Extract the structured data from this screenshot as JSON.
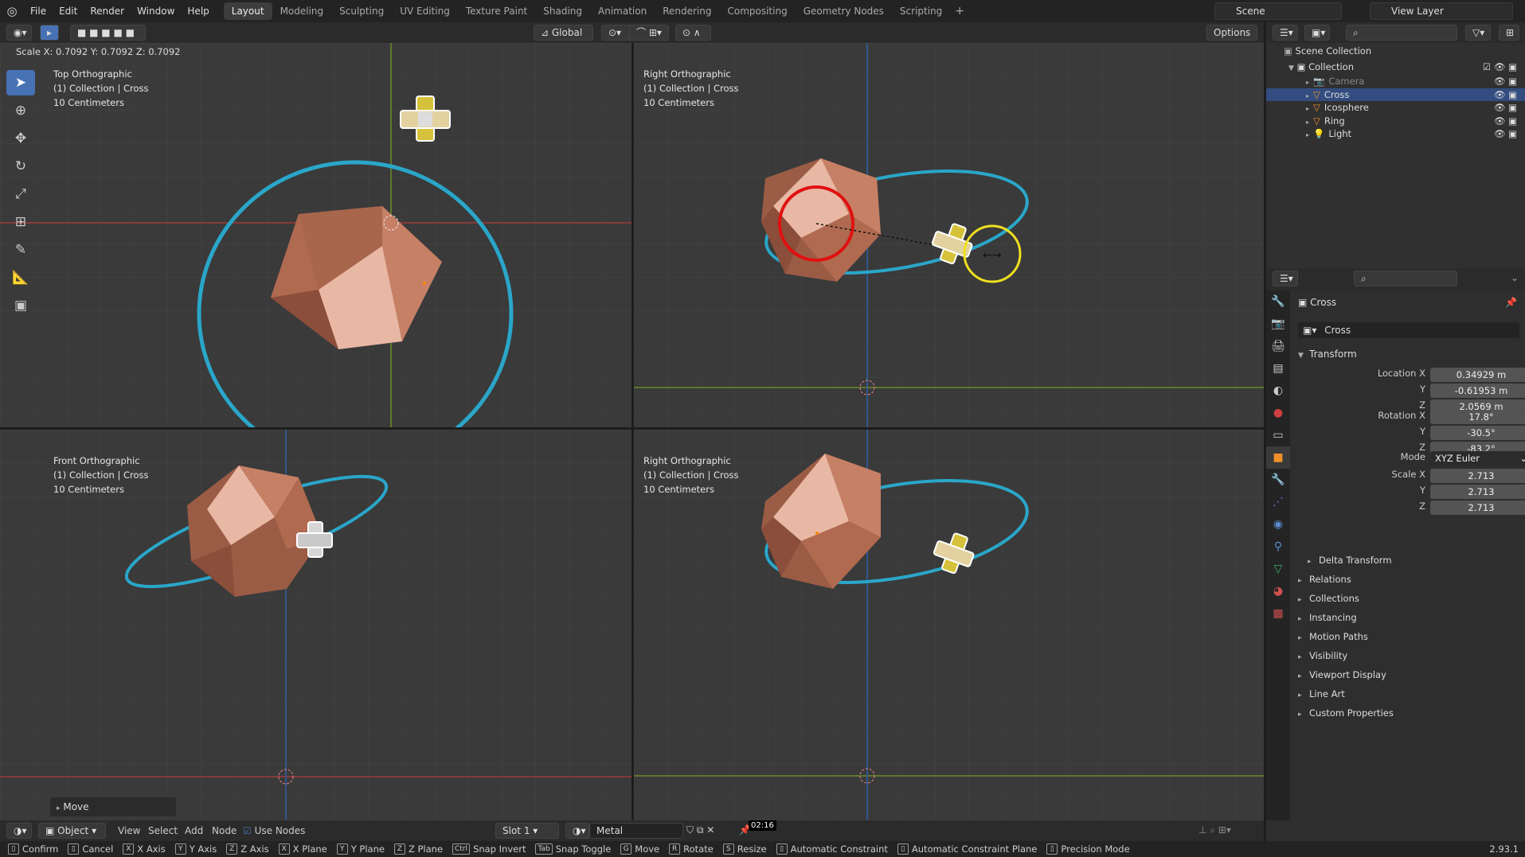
{
  "menu": [
    "File",
    "Edit",
    "Render",
    "Window",
    "Help"
  ],
  "workspaces": [
    "Layout",
    "Modeling",
    "Sculpting",
    "UV Editing",
    "Texture Paint",
    "Shading",
    "Animation",
    "Rendering",
    "Compositing",
    "Geometry Nodes",
    "Scripting"
  ],
  "scene": "Scene",
  "view_layer": "View Layer",
  "viewport_header": {
    "orientation": "Global",
    "options": "Options"
  },
  "scale_readout": "Scale X: 0.7092   Y: 0.7092  Z: 0.7092",
  "viewports": [
    {
      "title": "Top Orthographic",
      "collection": "(1) Collection | Cross",
      "scale": "10 Centimeters"
    },
    {
      "title": "Right Orthographic",
      "collection": "(1) Collection | Cross",
      "scale": "10 Centimeters"
    },
    {
      "title": "Front Orthographic",
      "collection": "(1) Collection | Cross",
      "scale": "10 Centimeters"
    },
    {
      "title": "Right Orthographic",
      "collection": "(1) Collection | Cross",
      "scale": "10 Centimeters"
    }
  ],
  "operator_panel": "Move",
  "outliner": {
    "scene_collection": "Scene Collection",
    "collection": "Collection",
    "items": [
      "Camera",
      "Cross",
      "Icosphere",
      "Ring",
      "Light"
    ]
  },
  "properties": {
    "object_name": "Cross",
    "data_name": "Cross",
    "transform_title": "Transform",
    "location_label": "Location X",
    "rotation_label": "Rotation X",
    "scale_label": "Scale X",
    "y_label": "Y",
    "z_label": "Z",
    "mode_label": "Mode",
    "location": [
      "0.34929 m",
      "-0.61953 m",
      "2.0569 m"
    ],
    "rotation": [
      "17.8°",
      "-30.5°",
      "-83.2°"
    ],
    "scale": [
      "2.713",
      "2.713",
      "2.713"
    ],
    "mode": "XYZ Euler",
    "delta": "Delta Transform",
    "panels": [
      "Relations",
      "Collections",
      "Instancing",
      "Motion Paths",
      "Visibility",
      "Viewport Display",
      "Line Art",
      "Custom Properties"
    ]
  },
  "bottom_header": {
    "mode": "Object",
    "menus": [
      "View",
      "Select",
      "Add",
      "Node"
    ],
    "use_nodes": "Use Nodes",
    "slot": "Slot 1",
    "material": "Metal",
    "timer": "02:16"
  },
  "statusbar": [
    {
      "key": "",
      "label": "Confirm"
    },
    {
      "key": "",
      "label": "Cancel"
    },
    {
      "key": "X",
      "label": "X Axis"
    },
    {
      "key": "Y",
      "label": "Y Axis"
    },
    {
      "key": "Z",
      "label": "Z Axis"
    },
    {
      "key": "X",
      "label": "X Plane"
    },
    {
      "key": "Y",
      "label": "Y Plane"
    },
    {
      "key": "Z",
      "label": "Z Plane"
    },
    {
      "key": "Ctrl",
      "label": "Snap Invert"
    },
    {
      "key": "Tab",
      "label": "Snap Toggle"
    },
    {
      "key": "G",
      "label": "Move"
    },
    {
      "key": "R",
      "label": "Rotate"
    },
    {
      "key": "S",
      "label": "Resize"
    },
    {
      "key": "",
      "label": "Automatic Constraint"
    },
    {
      "key": "",
      "label": "Automatic Constraint Plane"
    },
    {
      "key": "",
      "label": "Precision Mode"
    }
  ],
  "version": "2.93.1",
  "colors": {
    "ring": "#2aa6c9",
    "ico": "#b87a5e",
    "selected": "#334d80",
    "accent": "#4772b3"
  }
}
